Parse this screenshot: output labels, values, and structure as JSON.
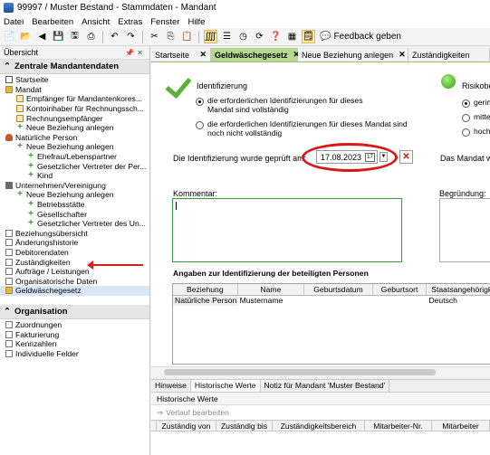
{
  "window": {
    "title": "99997 / Muster Bestand - Stammdaten - Mandant"
  },
  "menu": [
    "Datei",
    "Bearbeiten",
    "Ansicht",
    "Extras",
    "Fenster",
    "Hilfe"
  ],
  "toolbar": {
    "feedback_label": "Feedback geben"
  },
  "left_panel": {
    "header": "Übersicht",
    "sections": [
      {
        "label": "Zentrale Mandantendaten"
      },
      {
        "label": "Organisation"
      }
    ],
    "tree": [
      "Startseite",
      "Mandat",
      "Empfänger für Mandantenkores...",
      "Kontoinhaber für Rechnungssch...",
      "Rechnungsempfänger",
      "Neue Beziehung anlegen",
      "Natürliche Person",
      "Neue Beziehung anlegen",
      "Ehefrau/Lebenspartner",
      "Gesetzlicher Vertreter der Per...",
      "Kind",
      "Unternehmen/Vereinigung",
      "Neue Beziehung anlegen",
      "Betriebsstätte",
      "Gesellschafter",
      "Gesetzlicher Vertreter des Un...",
      "Beziehungsübersicht",
      "Änderungshistorie",
      "Debitorendaten",
      "Zuständigkeiten",
      "Aufträge / Leistungen",
      "Organisatorische Daten",
      "Geldwäschegesetz"
    ],
    "org_items": [
      "Zuordnungen",
      "Fakturierung",
      "Kennzahlen",
      "Individuelle Felder"
    ]
  },
  "tabs": [
    "Startseite",
    "Geldwäschegesetz",
    "Neue Beziehung anlegen",
    "Zuständigkeiten"
  ],
  "form": {
    "ident_label": "Identifizierung",
    "radio_complete": "die erforderlichen Identifizierungen für dieses Mandat sind vollständig",
    "radio_incomplete": "die erforderlichen Identifizierungen für dieses Mandat sind noch nicht vollständig",
    "risk_label": "Risikobe",
    "risk_options": [
      "gerin",
      "mitte",
      "hoch"
    ],
    "date_label": "Die Identifizierung wurde geprüft am:",
    "date_value": "17.08.2023",
    "mandat_label": "Das Mandat wu",
    "comment_label": "Kommentar:",
    "reason_label": "Begründung:"
  },
  "grid": {
    "title": "Angaben zur Identifizierung der beteiligten Personen",
    "columns": [
      "Beziehung",
      "Name",
      "Geburtsdatum",
      "Geburtsort",
      "Staatsangehörigk"
    ],
    "rows": [
      [
        "Natürliche Person",
        "Mustername",
        "",
        "",
        "Deutsch"
      ]
    ]
  },
  "bottom": {
    "tabs": [
      "Hinweise",
      "Historische Werte",
      "Notiz für Mandant 'Muster Bestand'"
    ],
    "section_label": "Historische Werte",
    "edit_label": "Verlauf bearbeiten",
    "columns": [
      "Zuständig von",
      "Zuständig bis",
      "Zuständigkeitsbereich",
      "Mitarbeiter-Nr.",
      "Mitarbeiter"
    ]
  }
}
